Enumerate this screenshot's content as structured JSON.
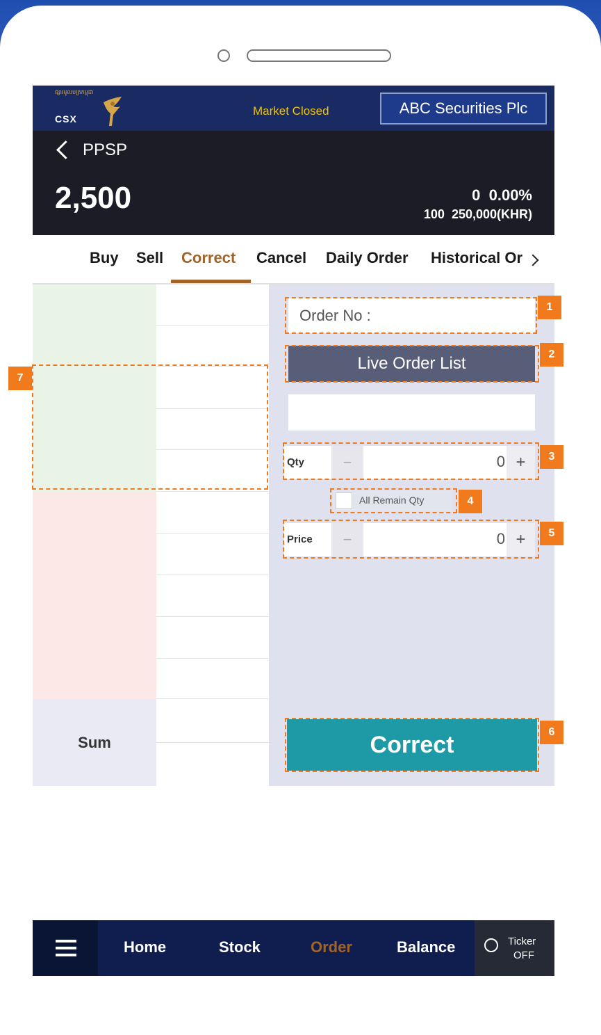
{
  "header": {
    "logo_khmer": "ផ្សារមូលបត្រកម្ពុជា",
    "logo_text": "CSX",
    "market_status": "Market Closed",
    "broker": "ABC Securities Plc"
  },
  "stock": {
    "symbol": "PPSP",
    "price": "2,500",
    "change": "0",
    "change_pct": "0.00%",
    "volume": "100",
    "value": "250,000(KHR)"
  },
  "tabs": [
    {
      "label": "Buy"
    },
    {
      "label": "Sell"
    },
    {
      "label": "Correct"
    },
    {
      "label": "Cancel"
    },
    {
      "label": "Daily Order"
    },
    {
      "label": "Historical Order"
    }
  ],
  "orderbook": {
    "sum_label": "Sum"
  },
  "form": {
    "order_no_placeholder": "Order No :",
    "live_order_list": "Live Order List",
    "qty_label": "Qty",
    "qty_value": "0",
    "all_remain": "All Remain Qty",
    "price_label": "Price",
    "price_value": "0",
    "minus": "−",
    "plus": "+",
    "submit": "Correct"
  },
  "callouts": [
    "1",
    "2",
    "3",
    "4",
    "5",
    "6",
    "7"
  ],
  "nav": {
    "home": "Home",
    "stock": "Stock",
    "order": "Order",
    "balance": "Balance",
    "ticker_1": "Ticker",
    "ticker_2": "OFF"
  },
  "colors": {
    "accent": "#a0642a",
    "callout": "#f07a1c",
    "correct_button": "#1e9aa6",
    "buy_side": "#e9f4e6",
    "sell_side": "#fde8e8"
  }
}
